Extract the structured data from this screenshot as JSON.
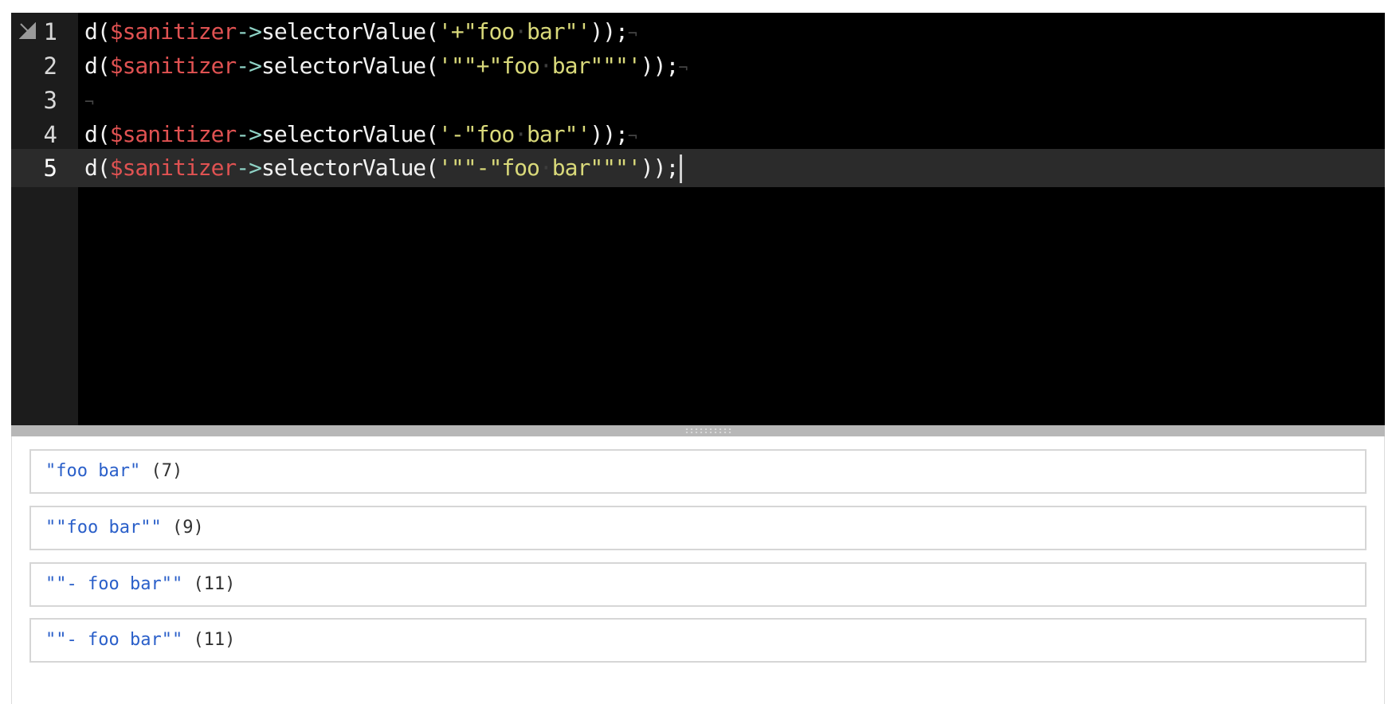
{
  "editor": {
    "lines": [
      {
        "number": "1",
        "tokens": [
          {
            "t": "fn",
            "v": "d("
          },
          {
            "t": "var",
            "v": "$sanitizer"
          },
          {
            "t": "op",
            "v": "->"
          },
          {
            "t": "fn",
            "v": "selectorValue("
          },
          {
            "t": "str",
            "v": "'+\"foo"
          },
          {
            "t": "ws",
            "v": "·"
          },
          {
            "t": "str",
            "v": "bar\"'"
          },
          {
            "t": "fn",
            "v": "));"
          }
        ],
        "eol": "¬"
      },
      {
        "number": "2",
        "tokens": [
          {
            "t": "fn",
            "v": "d("
          },
          {
            "t": "var",
            "v": "$sanitizer"
          },
          {
            "t": "op",
            "v": "->"
          },
          {
            "t": "fn",
            "v": "selectorValue("
          },
          {
            "t": "str",
            "v": "'\"\"+\"foo"
          },
          {
            "t": "ws",
            "v": "·"
          },
          {
            "t": "str",
            "v": "bar\"\"\"'"
          },
          {
            "t": "fn",
            "v": "));"
          }
        ],
        "eol": "¬"
      },
      {
        "number": "3",
        "tokens": [],
        "eol": "¬"
      },
      {
        "number": "4",
        "tokens": [
          {
            "t": "fn",
            "v": "d("
          },
          {
            "t": "var",
            "v": "$sanitizer"
          },
          {
            "t": "op",
            "v": "->"
          },
          {
            "t": "fn",
            "v": "selectorValue("
          },
          {
            "t": "str",
            "v": "'-\"foo"
          },
          {
            "t": "ws",
            "v": "·"
          },
          {
            "t": "str",
            "v": "bar\"'"
          },
          {
            "t": "fn",
            "v": "));"
          }
        ],
        "eol": "¬"
      },
      {
        "number": "5",
        "active": true,
        "tokens": [
          {
            "t": "fn",
            "v": "d("
          },
          {
            "t": "var",
            "v": "$sanitizer"
          },
          {
            "t": "op",
            "v": "->"
          },
          {
            "t": "fn",
            "v": "selectorValue("
          },
          {
            "t": "str",
            "v": "'\"\"-\"foo"
          },
          {
            "t": "ws",
            "v": "·"
          },
          {
            "t": "str",
            "v": "bar\"\"\"'"
          },
          {
            "t": "fn",
            "v": "));"
          }
        ],
        "eol": ""
      }
    ]
  },
  "output": {
    "results": [
      {
        "value": "\"foo bar\"",
        "length": "(7)"
      },
      {
        "value": "\"\"foo bar\"\"",
        "length": "(9)"
      },
      {
        "value": "\"\"- foo bar\"\"",
        "length": "(11)"
      },
      {
        "value": "\"\"- foo bar\"\"",
        "length": "(11)"
      }
    ]
  },
  "icons": {
    "fold": "fold-triangle-icon",
    "splitter": "drag-grip-icon"
  },
  "colors": {
    "editor_bg": "#000000",
    "gutter_bg": "#1c1c1c",
    "active_line": "#2b2b2b",
    "variable": "#e05252",
    "operator": "#8fd3c6",
    "string": "#d9d97a",
    "result_value": "#2a5fc9"
  }
}
